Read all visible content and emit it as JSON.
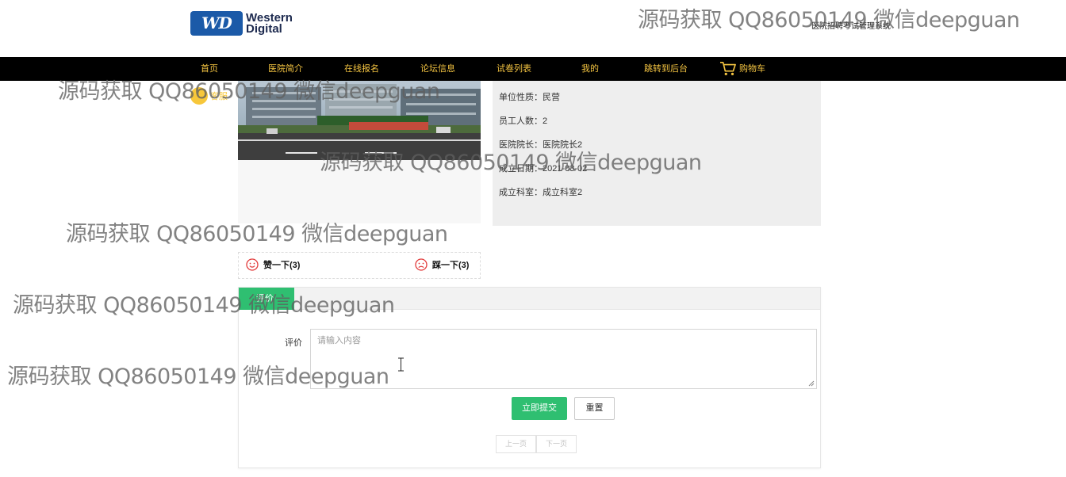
{
  "header": {
    "logo": {
      "badge": "WD",
      "line1": "Western",
      "line2": "Digital"
    },
    "system_title": "医院招聘考试管理系统"
  },
  "nav": {
    "items": [
      {
        "label": "首页"
      },
      {
        "label": "医院简介"
      },
      {
        "label": "在线报名"
      },
      {
        "label": "论坛信息"
      },
      {
        "label": "试卷列表"
      },
      {
        "label": "我的"
      },
      {
        "label": "跳转到后台"
      }
    ],
    "cart_label": "购物车"
  },
  "service": {
    "label": "客服"
  },
  "info": {
    "rows": [
      {
        "label": "单位性质：",
        "value": "民营"
      },
      {
        "label": "员工人数：",
        "value": "2"
      },
      {
        "label": "医院院长：",
        "value": "医院院长2"
      },
      {
        "label": "成立日期：",
        "value": "2021-03-02"
      },
      {
        "label": "成立科室：",
        "value": "成立科室2"
      }
    ]
  },
  "votes": {
    "like": "赞一下(3)",
    "dislike": "踩一下(3)"
  },
  "comment": {
    "tab_label": "评价",
    "field_label": "评价",
    "placeholder": "请输入内容",
    "submit_label": "立即提交",
    "reset_label": "重置",
    "prev_label": "上一页",
    "next_label": "下一页"
  },
  "watermark": {
    "text": "源码获取 QQ86050149 微信deepguan"
  },
  "colors": {
    "nav_bg": "#000000",
    "nav_text": "#f5c542",
    "accent_green": "#2fbf71",
    "service_yellow": "#f7c73a",
    "logo_blue": "#1b5aa8"
  }
}
